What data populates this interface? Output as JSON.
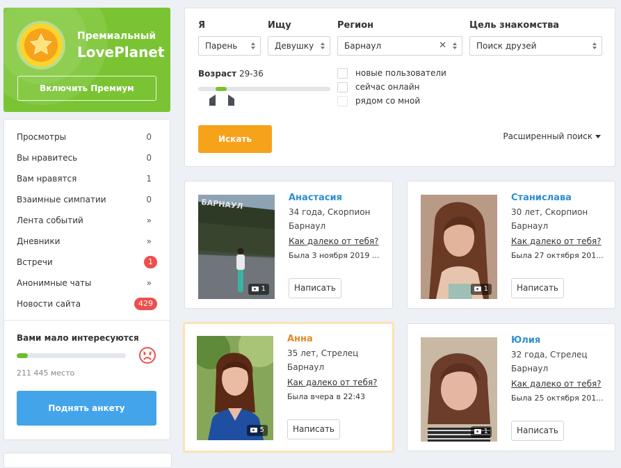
{
  "premium": {
    "title_line1": "Премиальный",
    "title_line2": "LovePlanet",
    "button": "Включить Премиум"
  },
  "stats": {
    "items": [
      {
        "label": "Просмотры",
        "value": "0"
      },
      {
        "label": "Вы нравитесь",
        "value": "0"
      },
      {
        "label": "Вам нравятся",
        "value": "1"
      },
      {
        "label": "Взаимные симпатии",
        "value": "0"
      },
      {
        "label": "Лента событий",
        "value": "»"
      },
      {
        "label": "Дневники",
        "value": "»"
      },
      {
        "label": "Встречи",
        "value": "1"
      },
      {
        "label": "Анонимные чаты",
        "value": "»"
      },
      {
        "label": "Новости сайта",
        "value": "429"
      }
    ],
    "interest_title": "Вами мало интересуются",
    "interest_progress": 0.1,
    "place": "211 445 место",
    "raise_button": "Поднять анкету",
    "colors": {
      "badge": "#ee4e4e",
      "progress": "#6dbe2a",
      "raise": "#43a4ea"
    }
  },
  "search": {
    "labels": {
      "me": "Я",
      "seeking": "Ищу",
      "region": "Регион",
      "goal": "Цель знакомства"
    },
    "values": {
      "me": "Парень",
      "seeking": "Девушку",
      "region": "Барнаул",
      "goal": "Поиск друзей"
    },
    "age_label": "Возраст",
    "age_value": "29-36",
    "checkboxes": [
      "новые пользователи",
      "сейчас онлайн",
      "рядом со мной"
    ],
    "search_button": "Искать",
    "advanced": "Расширенный поиск",
    "colors": {
      "search_button": "#f7a21b",
      "age_range": "#7cc130"
    }
  },
  "profiles": [
    {
      "name": "Анастасия",
      "age": "34 года, Скорпион",
      "city": "Барнаул",
      "distance": "Как далеко от тебя?",
      "last_seen": "Была 3 ноября 2019 ...",
      "photos": "1",
      "write": "Написать"
    },
    {
      "name": "Станислава",
      "age": "30 лет, Скорпион",
      "city": "Барнаул",
      "distance": "Как далеко от тебя?",
      "last_seen": "Была 27 октября 201...",
      "photos": "1",
      "write": "Написать"
    },
    {
      "name": "Анна",
      "age": "35 лет, Стрелец",
      "city": "Барнаул",
      "distance": "Как далеко от тебя?",
      "last_seen": "Была вчера в 22:43",
      "photos": "5",
      "write": "Написать"
    },
    {
      "name": "Юлия",
      "age": "32 года, Стрелец",
      "city": "Барнаул",
      "distance": "Как далеко от тебя?",
      "last_seen": "Была 25 октября 201...",
      "photos": "1",
      "write": "Написать"
    }
  ]
}
